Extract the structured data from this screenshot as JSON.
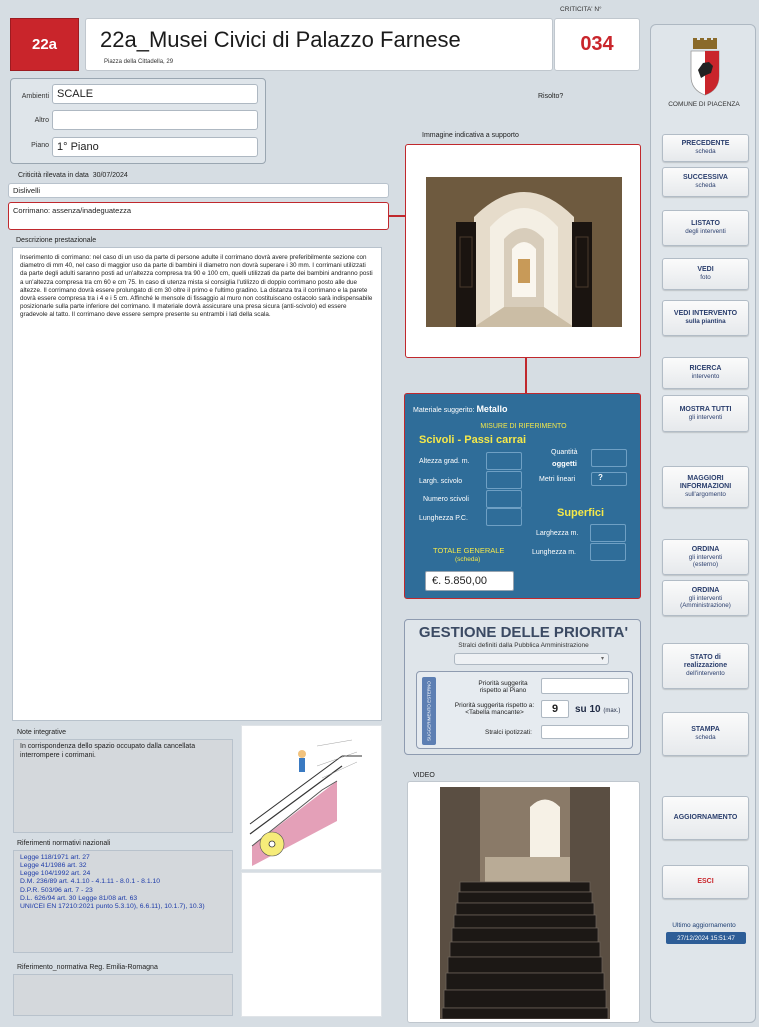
{
  "header": {
    "code": "22a",
    "title": "22a_Musei Civici di Palazzo Farnese",
    "address": "Piazza della Cittadella, 29",
    "criticita_label": "CRITICITA' N°",
    "criticita_number": "034"
  },
  "ambienti": {
    "ambienti_label": "Ambienti",
    "ambienti_value": "SCALE",
    "altro_label": "Altro",
    "altro_value": "",
    "piano_label": "Piano",
    "piano_value": "1° Piano"
  },
  "risolto_label": "Risolto?",
  "criticita_rilevata": {
    "label": "Criticità rilevata in data",
    "date": "30/07/2024"
  },
  "categoria": "Dislivelli",
  "criticita_desc": "Corrimano: assenza/inadeguatezza",
  "descrizione": {
    "label": "Descrizione  prestazionale",
    "text": "Inserimento di corrimano: nel caso di un uso da parte di persone adulte il corrimano dovrà avere preferibilmente sezione con diametro di mm 40, nel caso di maggior uso da parte di bambini il diametro non dovrà superare i 30 mm. I corrimani utilizzati da parte degli adulti saranno posti ad un'altezza compresa tra 90 e 100 cm, quelli utilizzati da parte dei bambini andranno posti a un'altezza compresa tra cm 60 e cm 75. In caso di utenza mista si consiglia l'utilizzo di doppio corrimano posto alle due altezze. Il corrimano dovrà essere prolungato di cm 30 oltre il primo e l'ultimo gradino. La distanza tra il corrimano e la parete dovrà essere compresa tra i 4 e i 5 cm. Affinché le mensole di fissaggio al muro non costituiscano ostacolo sarà indispensabile posizionarle sulla parte inferiore del corrimano. Il materiale dovrà assicurare una presa sicura (anti-scivolo) ed essere gradevole al tatto. Il corrimano deve essere sempre presente su entrambi i lati della scala."
  },
  "immagine_label": "Immagine indicativa a supporto",
  "materiale": {
    "suggerito_label": "Materiale suggerito:",
    "suggerito_value": "Metallo",
    "misure_label": "MISURE DI RIFERIMENTO",
    "scivoli_title": "Scivoli - Passi carrai",
    "altezza_label": "Altezza grad. m.",
    "largh_label": "Largh. scivolo",
    "numero_label": "Numero scivoli",
    "lunghezza_pc_label": "Lunghezza P.C.",
    "quantita_label": "Quantità",
    "oggetti_label": "oggetti",
    "metri_lineari_label": "Metri lineari",
    "metri_lineari_value": "?",
    "superfici_title": "Superfici",
    "larghezza_label": "Larghezza m.",
    "lunghezza_label": "Lunghezza m.",
    "totale_label": "TOTALE GENERALE",
    "totale_sub": "(scheda)",
    "totale_value": "€.  5.850,00"
  },
  "priorita": {
    "title": "GESTIONE DELLE PRIORITA'",
    "subtitle": "Stralci definiti dalla Pubblica Amministrazione",
    "vertical_label": "SUGGERIMENTO ESTERNO",
    "piano_label_1": "Priorità suggerita",
    "piano_label_2": "rispetto al Piano",
    "tabella_label_1": "Priorità suggerita rispetto a:",
    "tabella_label_2": "<Tabella mancante>",
    "priority_value": "9",
    "su_label": "su 10",
    "max_label": "(max.)",
    "stralci_label": "Stralci ipotizzati:"
  },
  "video_label": "VIDEO",
  "note": {
    "label": "Note integrative",
    "text": "In corrispondenza dello spazio occupato dalla cancellata interrompere i corrimani."
  },
  "riferimenti_nazionali": {
    "label": "Riferimenti normativi nazionali",
    "lines": [
      "Legge 118/1971 art. 27",
      "Legge 41/1986 art. 32",
      "Legge 104/1992 art. 24",
      "D.M. 236/89 art. 4.1.10 - 4.1.11 - 8.0.1 - 8.1.10",
      "D.P.R. 503/96 art. 7 - 23",
      "D.L. 626/94 art. 30   Legge 81/08 art. 63",
      "UNI/CEI EN 17210:2021  punto 5.3.10), 6.6.11), 10.1.7), 10.3)"
    ]
  },
  "riferimento_er_label": "Riferimento_normativa Reg. Emilia-Romagna",
  "sidebar": {
    "logo_caption": "COMUNE DI PIACENZA",
    "buttons": [
      {
        "l1": "PRECEDENTE",
        "l2": "scheda"
      },
      {
        "l1": "SUCCESSIVA",
        "l2": "scheda"
      },
      {
        "l1": "LISTATO",
        "l2": "degli interventi"
      },
      {
        "l1": "VEDI",
        "l2": "foto"
      },
      {
        "l1": "VEDI INTERVENTO",
        "l2": "sulla piantina"
      },
      {
        "l1": "RICERCA",
        "l2": "intervento"
      },
      {
        "l1": "MOSTRA TUTTI",
        "l2": "gli interventi"
      },
      {
        "l1": "MAGGIORI INFORMAZIONI",
        "l2": "sull'argomento"
      },
      {
        "l1": "ORDINA",
        "l2": "gli interventi (esterno)"
      },
      {
        "l1": "ORDINA",
        "l2": "gli interventi (Amministrazione)"
      },
      {
        "l1": "STATO di realizzazione",
        "l2": "dell'intervento"
      },
      {
        "l1": "STAMPA",
        "l2": "scheda"
      },
      {
        "l1": "AGGIORNAMENTO",
        "l2": ""
      },
      {
        "l1": "ESCI",
        "l2": ""
      }
    ],
    "ultimo_label": "Ultimo aggiornamento",
    "ultimo_value": "27/12/2024 15:51:47"
  },
  "colors": {
    "accent_red": "#c9252b",
    "panel_blue": "#2f6d99",
    "highlight_yellow": "#f4e84a"
  }
}
